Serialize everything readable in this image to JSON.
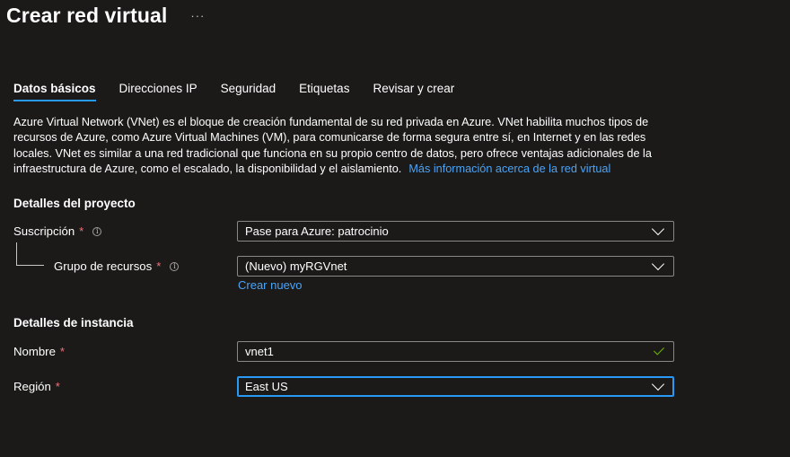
{
  "header": {
    "title": "Crear red virtual",
    "more_label": "···"
  },
  "tabs": [
    {
      "label": "Datos básicos",
      "active": true
    },
    {
      "label": "Direcciones IP",
      "active": false
    },
    {
      "label": "Seguridad",
      "active": false
    },
    {
      "label": "Etiquetas",
      "active": false
    },
    {
      "label": "Revisar y crear",
      "active": false
    }
  ],
  "description": {
    "text": "Azure Virtual Network (VNet) es el bloque de creación fundamental de su red privada en Azure. VNet habilita muchos tipos de recursos de Azure, como Azure Virtual Machines (VM), para comunicarse de forma segura entre sí, en Internet y en las redes locales. VNet es similar a una red tradicional que funciona en su propio centro de datos, pero ofrece ventajas adicionales de la infraestructura de Azure, como el escalado, la disponibilidad y el aislamiento.",
    "link": "Más información acerca de la red virtual"
  },
  "project_details": {
    "title": "Detalles del proyecto",
    "subscription": {
      "label": "Suscripción",
      "required": "*",
      "value": "Pase para Azure: patrocinio"
    },
    "resource_group": {
      "label": "Grupo de recursos",
      "required": "*",
      "value": "(Nuevo) myRGVnet",
      "create_new": "Crear nuevo"
    }
  },
  "instance_details": {
    "title": "Detalles de instancia",
    "name": {
      "label": "Nombre",
      "required": "*",
      "value": "vnet1"
    },
    "region": {
      "label": "Región",
      "required": "*",
      "value": "East US"
    }
  },
  "colors": {
    "accent": "#2899f5",
    "link": "#4ba3f5",
    "required": "#f1707b",
    "valid": "#6bb700",
    "background": "#1b1a19"
  },
  "icons": [
    "info-icon",
    "chevron-down-icon",
    "checkmark-icon",
    "more-icon"
  ]
}
